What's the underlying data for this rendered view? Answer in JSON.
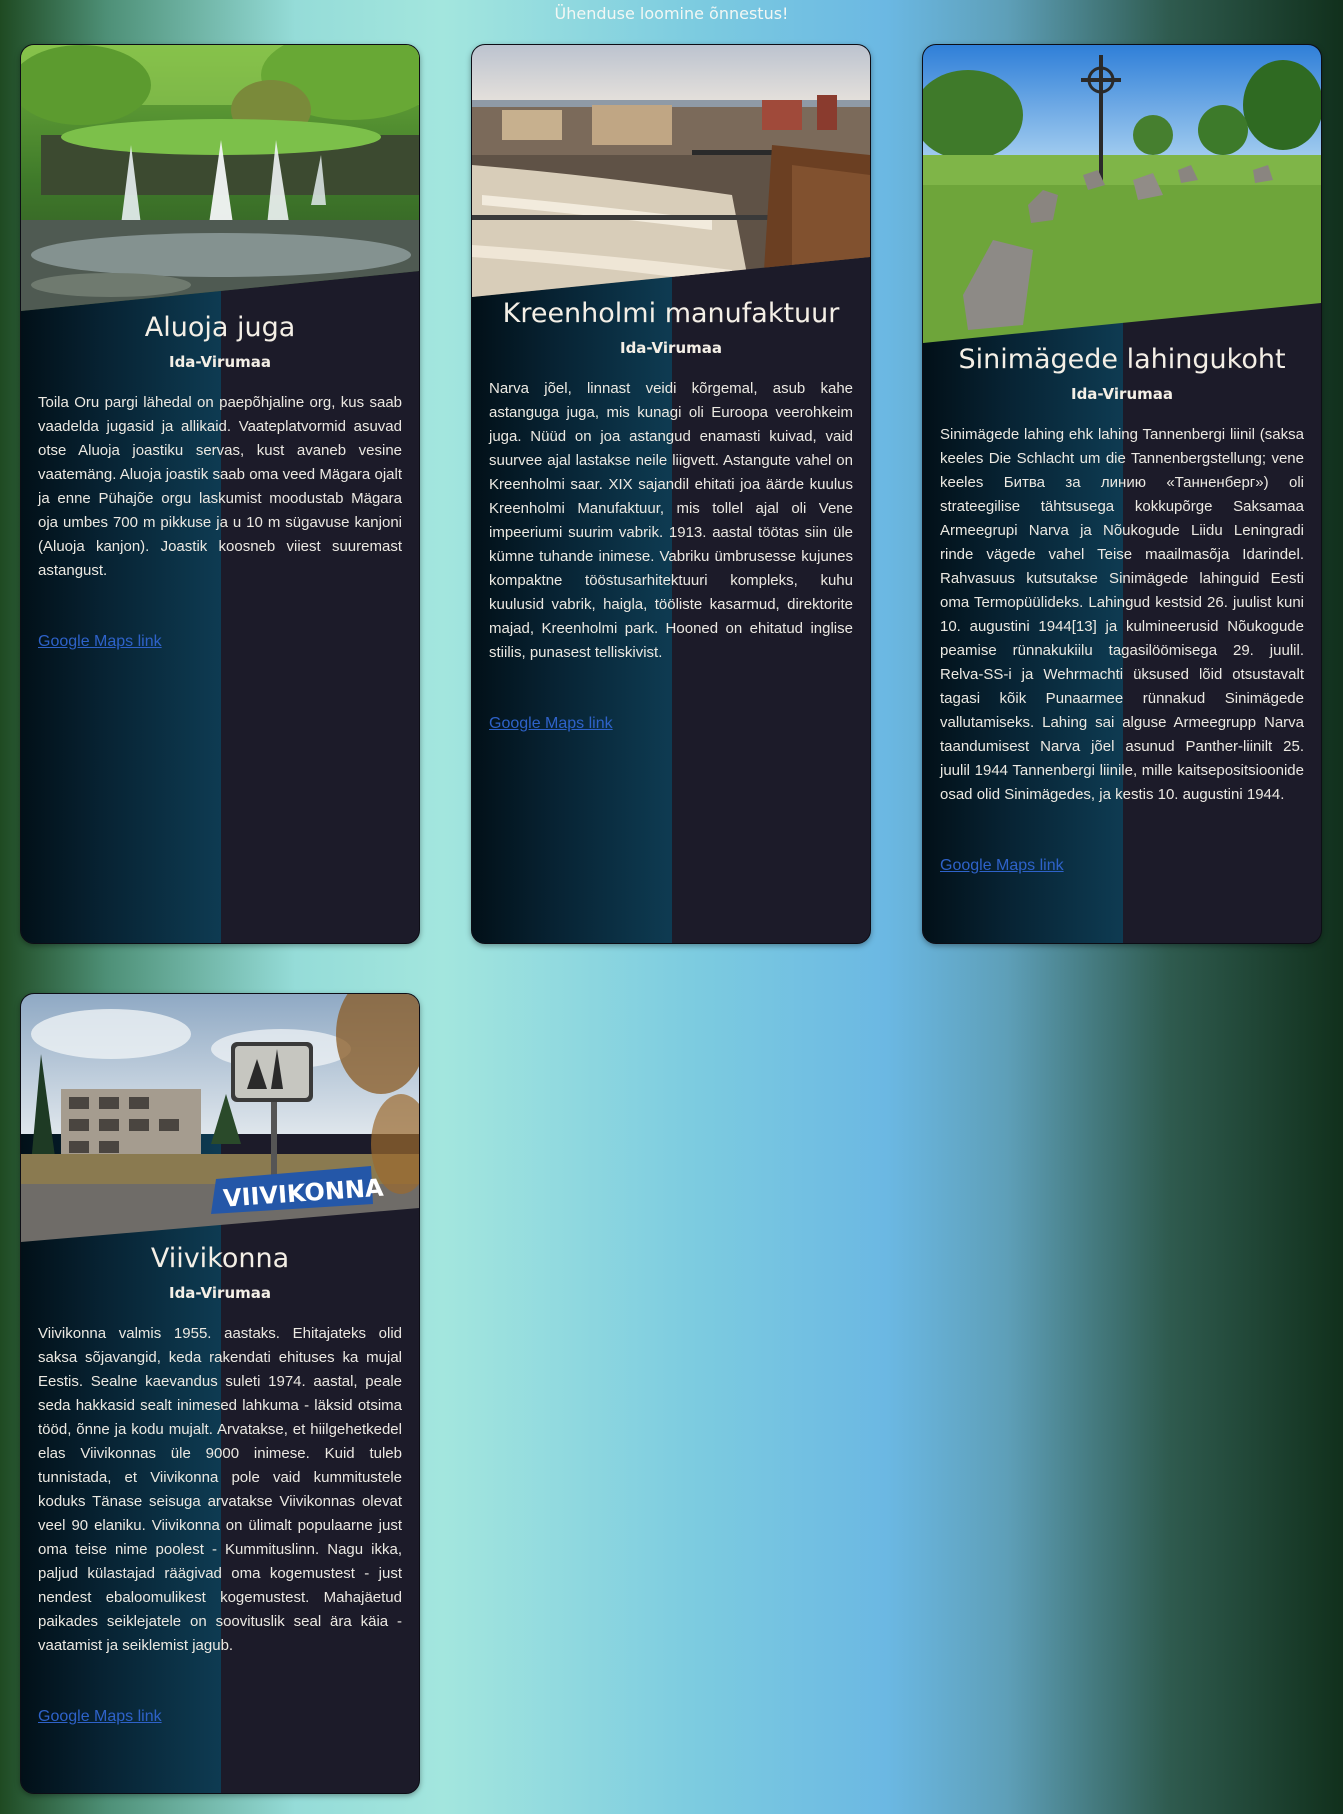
{
  "status": "Ühenduse loomine õnnestus!",
  "cards": [
    {
      "title": "Aluoja juga",
      "region": "Ida-Virumaa",
      "text": "Toila Oru pargi lähedal on paepõhjaline org, kus saab vaadelda jugasid ja allikaid. Vaateplatvormid asuvad otse Aluoja joastiku servas, kust avaneb vesine vaatemäng. Aluoja joastik saab oma veed Mägara ojalt ja enne Pühajõe orgu laskumist moodustab Mägara oja umbes 700 m pikkuse ja u 10 m sügavuse kanjoni (Aluoja kanjon). Joastik koosneb viiest suuremast astangust.",
      "link": "Google Maps link",
      "image": "waterfall-photo"
    },
    {
      "title": "Kreenholmi manufaktuur",
      "region": "Ida-Virumaa",
      "text": "Narva jõel, linnast veidi kõrgemal, asub kahe astanguga juga, mis kunagi oli Euroopa veerohkeim juga. Nüüd on joa astangud enamasti kuivad, vaid suurvee ajal lastakse neile liigvett. Astangute vahel on Kreenholmi saar. XIX sajandil ehitati joa äärde kuulus Kreenholmi Manufaktuur, mis tollel ajal oli Vene impeeriumi suurim vabrik. 1913. aastal töötas siin üle kümne tuhande inimese. Vabriku ümbrusesse kujunes kompaktne tööstusarhitektuuri kompleks, kuhu kuulusid vabrik, haigla, tööliste kasarmud, direktorite majad, Kreenholmi park. Hooned on ehitatud inglise stiilis, punasest telliskivist.",
      "link": "Google Maps link",
      "image": "factory-river-photo"
    },
    {
      "title": "Sinimägede lahingukoht",
      "region": "Ida-Virumaa",
      "text": "Sinimägede lahing ehk lahing Tannenbergi liinil (saksa keeles Die Schlacht um die Tannenbergstellung; vene keeles Битва за линию «Танненберг») oli strateegilise tähtsusega kokkupõrge Saksamaa Armeegrupi Narva ja Nõukogude Liidu Leningradi rinde vägede vahel Teise maailmasõja Idarindel. Rahvasuus kutsutakse Sinimägede lahinguid Eesti oma Termopüülideks. Lahingud kestsid 26. juulist kuni 10. augustini 1944[13] ja kulmineerusid Nõukogude peamise rünnakukiilu tagasilöömisega 29. juulil. Relva-SS-i ja Wehrmachti üksused lõid otsustavalt tagasi kõik Punaarmee rünnakud Sinimägede vallutamiseks. Lahing sai alguse Armeegrupp Narva taandumisest Narva jõel asunud Panther-liinilt 25. juulil 1944 Tannenbergi liinile, mille kaitsepositsioonide osad olid Sinimägedes, ja kestis 10. augustini 1944.",
      "link": "Google Maps link",
      "image": "battlefield-memorial-photo"
    },
    {
      "title": "Viivikonna",
      "region": "Ida-Virumaa",
      "text": "Viivikonna valmis 1955. aastaks. Ehitajateks olid saksa sõjavangid, keda rakendati ehituses ka mujal Eestis. Sealne kaevandus suleti 1974. aastal, peale seda hakkasid sealt inimesed lahkuma - läksid otsima tööd, õnne ja kodu mujalt. Arvatakse, et hiilgehetkedel elas Viivikonnas üle 9000 inimese. Kuid tuleb tunnistada, et Viivikonna pole vaid kummitustele koduks Tänase seisuga arvatakse Viivikonnas olevat veel 90 elaniku. Viivikonna on ülimalt populaarne just oma teise nime poolest - Kummituslinn. Nagu ikka, paljud külastajad räägivad oma kogemustest - just nendest ebaloomulikest kogemustest. Mahajäetud paikades seiklejatele on soovituslik seal ära käia - vaatamist ja seiklemist jagub.",
      "link": "Google Maps link",
      "image": "abandoned-town-photo",
      "sign_text": "VIIVIKONNA"
    }
  ]
}
